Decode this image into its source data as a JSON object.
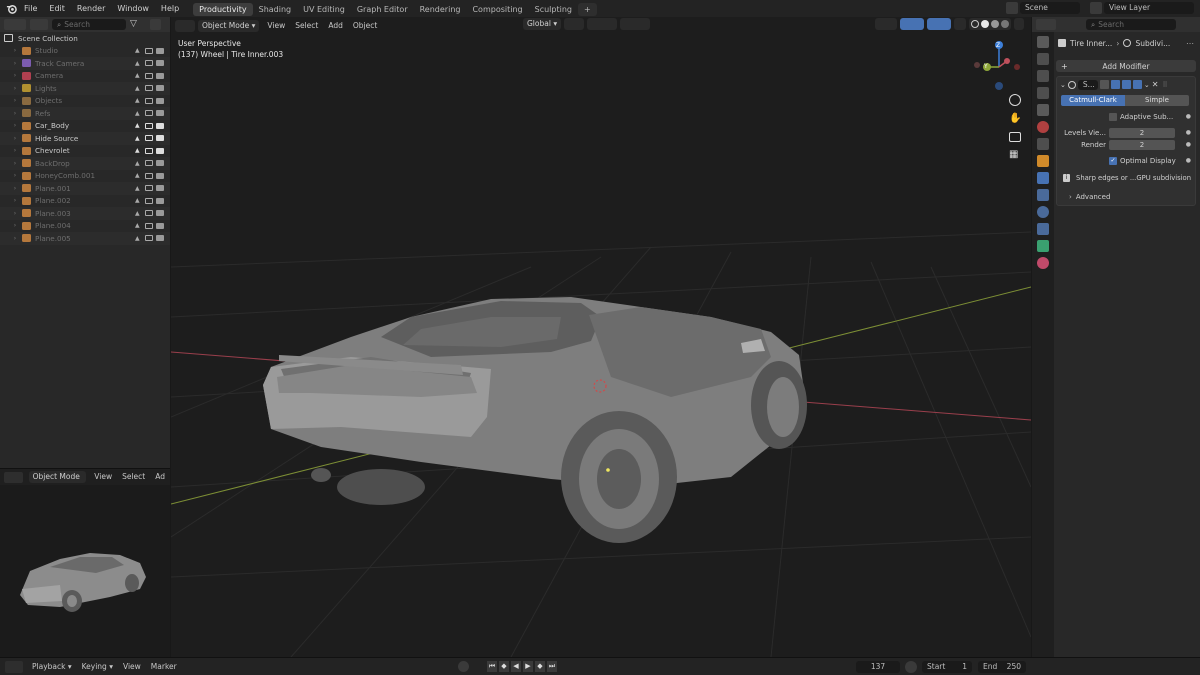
{
  "topbar": {
    "menus": [
      "File",
      "Edit",
      "Render",
      "Window",
      "Help"
    ],
    "workspaces": [
      "Productivity",
      "Shading",
      "UV Editing",
      "Graph Editor",
      "Rendering",
      "Compositing",
      "Sculpting"
    ],
    "active_workspace": "Productivity",
    "add_tab": "+",
    "scene_label": "Scene",
    "view_layer_label": "View Layer"
  },
  "outliner": {
    "search_placeholder": "Search",
    "root": "Scene Collection",
    "items": [
      {
        "label": "Studio",
        "dim": true,
        "color": "#b5783c"
      },
      {
        "label": "Track Camera",
        "dim": true,
        "color": "#7c5cb0"
      },
      {
        "label": "Camera",
        "dim": true,
        "color": "#b04050"
      },
      {
        "label": "Lights",
        "dim": true,
        "color": "#b09030"
      },
      {
        "label": "Objects",
        "dim": true,
        "color": "#8a6a40"
      },
      {
        "label": "Refs",
        "dim": true,
        "color": "#8a6a40"
      },
      {
        "label": "Car_Body",
        "dim": false,
        "color": "#b5783c"
      },
      {
        "label": "Hide Source",
        "dim": false,
        "color": "#b5783c"
      },
      {
        "label": "Chevrolet",
        "dim": false,
        "color": "#b5783c"
      },
      {
        "label": "BackDrop",
        "dim": true,
        "color": "#b5783c"
      },
      {
        "label": "HoneyComb.001",
        "dim": true,
        "color": "#b5783c"
      },
      {
        "label": "Plane.001",
        "dim": true,
        "color": "#b5783c"
      },
      {
        "label": "Plane.002",
        "dim": true,
        "color": "#b5783c"
      },
      {
        "label": "Plane.003",
        "dim": true,
        "color": "#b5783c"
      },
      {
        "label": "Plane.004",
        "dim": true,
        "color": "#b5783c"
      },
      {
        "label": "Plane.005",
        "dim": true,
        "color": "#b5783c"
      }
    ]
  },
  "preview_header": {
    "mode": "Object Mode",
    "menus": [
      "View",
      "Select",
      "Ad"
    ]
  },
  "viewport": {
    "mode": "Object Mode",
    "menus": [
      "View",
      "Select",
      "Add",
      "Object"
    ],
    "transform_orientation": "Global",
    "overlay_title": "User Perspective",
    "overlay_subtitle": "(137) Wheel | Tire Inner.003",
    "gizmo_z": "Z",
    "gizmo_y": "Y"
  },
  "properties": {
    "search_placeholder": "Search",
    "breadcrumb_object": "Tire Inner...",
    "breadcrumb_modifier": "Subdivi...",
    "add_modifier": "Add Modifier",
    "modifier_name": "S...",
    "tab_catmull": "Catmull-Clark",
    "tab_simple": "Simple",
    "adaptive_label": "Adaptive Sub...",
    "levels_label": "Levels Vie...",
    "levels_value": "2",
    "render_label": "Render",
    "render_value": "2",
    "optimal_label": "Optimal Display",
    "info_text": "Sharp edges or ...GPU subdivision",
    "advanced_label": "Advanced"
  },
  "timeline": {
    "menus": [
      "Playback",
      "Keying",
      "View",
      "Marker"
    ],
    "current_frame": "137",
    "start_label": "Start",
    "start_value": "1",
    "end_label": "End",
    "end_value": "250"
  },
  "colors": {
    "accent": "#4772b3",
    "x_axis": "#c0505c",
    "y_axis": "#8fa83a",
    "z_axis": "#3d7fd9"
  }
}
